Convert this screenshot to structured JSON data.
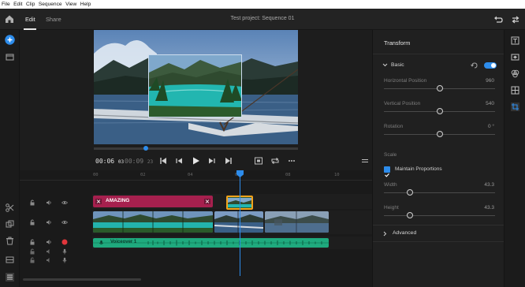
{
  "menubar": {
    "items": [
      "File",
      "Edit",
      "Clip",
      "Sequence",
      "View",
      "Help"
    ]
  },
  "header": {
    "tabs": [
      "Edit",
      "Share"
    ],
    "active_tab": "Edit",
    "title": "Test project: Sequence 01"
  },
  "monitor": {
    "current_time": "00:06",
    "current_frames": "03",
    "duration": "00:09",
    "duration_frames": "23",
    "playhead_fraction": 0.62
  },
  "timeline": {
    "ruler_ticks": [
      "00",
      "02",
      "04",
      "06",
      "08",
      "10"
    ],
    "title_clip_label": "AMAZING",
    "audio_clip_label": "Voiceover 1"
  },
  "panel": {
    "title": "Transform",
    "basic_label": "Basic",
    "basic_enabled": true,
    "horizontal_position": {
      "label": "Horizontal Position",
      "value": "960",
      "slider": 0.5
    },
    "vertical_position": {
      "label": "Vertical Position",
      "value": "540",
      "slider": 0.5
    },
    "rotation": {
      "label": "Rotation",
      "value": "0 °",
      "slider": 0.5
    },
    "scale_label": "Scale",
    "maintain_proportions": {
      "label": "Maintain Proportions",
      "checked": true
    },
    "width": {
      "label": "Width",
      "value": "43.3",
      "slider": 0.25
    },
    "height": {
      "label": "Height",
      "value": "43.3",
      "slider": 0.25
    },
    "advanced_label": "Advanced"
  },
  "colors": {
    "accent": "#2d8ceb",
    "title_clip": "#a6204e",
    "audio_clip": "#1faa7e",
    "selected_clip_border": "#f2a31b"
  }
}
